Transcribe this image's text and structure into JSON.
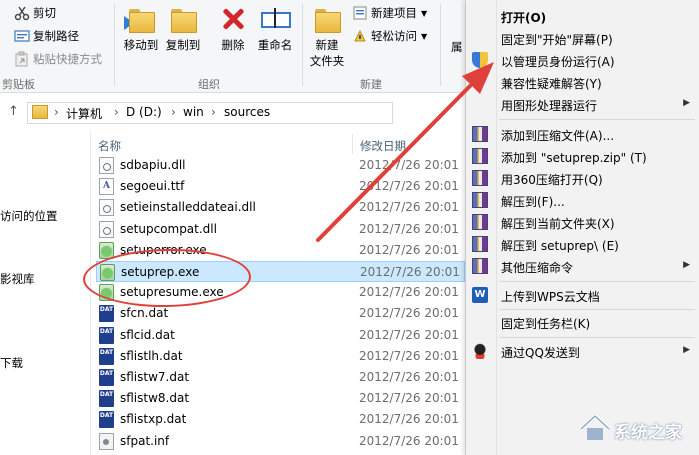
{
  "ribbon": {
    "clipboard": {
      "cut": "剪切",
      "copy_path": "复制路径",
      "paste_shortcut": "粘贴快捷方式",
      "group_label": "剪贴板"
    },
    "organize": {
      "move_to": "移动到",
      "copy_to": "复制到",
      "delete": "删除",
      "rename": "重命名",
      "group_label": "组织"
    },
    "new": {
      "new_folder_line1": "新建",
      "new_folder_line2": "文件夹",
      "new_item": "新建项目",
      "easy_access": "轻松访问",
      "group_label": "新建"
    },
    "properties_partial": "属"
  },
  "address_bar": {
    "crumbs": [
      "计算机",
      "D (D:)",
      "win",
      "sources"
    ]
  },
  "nav_pane": {
    "items": [
      "访问的位置",
      "影视库",
      "下载"
    ]
  },
  "file_list": {
    "columns": {
      "name": "名称",
      "modified": "修改日期"
    },
    "rows": [
      {
        "name": "sdbapiu.dll",
        "date": "2012/7/26 20:01",
        "icon": "dll-file-icon",
        "selected": false
      },
      {
        "name": "segoeui.ttf",
        "date": "2012/7/26 20:01",
        "icon": "font-file-icon",
        "selected": false
      },
      {
        "name": "setieinstalleddateai.dll",
        "date": "2012/7/26 20:01",
        "icon": "dll-file-icon",
        "selected": false
      },
      {
        "name": "setupcompat.dll",
        "date": "2012/7/26 20:01",
        "icon": "dll-file-icon",
        "selected": false
      },
      {
        "name": "setuperror.exe",
        "date": "2012/7/26 20:01",
        "icon": "exe-file-icon",
        "selected": false
      },
      {
        "name": "setuprep.exe",
        "date": "2012/7/26 20:01",
        "icon": "exe-file-icon",
        "selected": true
      },
      {
        "name": "setupresume.exe",
        "date": "2012/7/26 20:01",
        "icon": "exe-file-icon",
        "selected": false
      },
      {
        "name": "sfcn.dat",
        "date": "2012/7/26 20:01",
        "icon": "dat-file-icon",
        "selected": false
      },
      {
        "name": "sflcid.dat",
        "date": "2012/7/26 20:01",
        "icon": "dat-file-icon",
        "selected": false
      },
      {
        "name": "sflistlh.dat",
        "date": "2012/7/26 20:01",
        "icon": "dat-file-icon",
        "selected": false
      },
      {
        "name": "sflistw7.dat",
        "date": "2012/7/26 20:01",
        "icon": "dat-file-icon",
        "selected": false
      },
      {
        "name": "sflistw8.dat",
        "date": "2012/7/26 20:01",
        "icon": "dat-file-icon",
        "selected": false
      },
      {
        "name": "sflistxp.dat",
        "date": "2012/7/26 20:01",
        "icon": "dat-file-icon",
        "selected": false
      },
      {
        "name": "sfpat.inf",
        "date": "2012/7/26 20:01",
        "icon": "inf-file-icon",
        "selected": false
      }
    ]
  },
  "context_menu": {
    "open": "打开(O)",
    "pin_start": "固定到\"开始\"屏幕(P)",
    "run_as_admin": "以管理员身份运行(A)",
    "compat_troubleshoot": "兼容性疑难解答(Y)",
    "run_with_gpu": "用图形处理器运行",
    "add_to_archive": "添加到压缩文件(A)...",
    "add_to_zip": "添加到 \"setuprep.zip\" (T)",
    "open_with_360": "用360压缩打开(Q)",
    "extract_to": "解压到(F)...",
    "extract_here": "解压到当前文件夹(X)",
    "extract_to_folder": "解压到 setuprep\\ (E)",
    "other_compress": "其他压缩命令",
    "upload_wps": "上传到WPS云文档",
    "pin_taskbar": "固定到任务栏(K)",
    "send_qq": "通过QQ发送到"
  },
  "watermark": {
    "text": "系统之家"
  },
  "colors": {
    "highlight_red": "#e0403a",
    "selection_blue": "#cce8ff",
    "menu_bg": "#f2f2f2"
  }
}
